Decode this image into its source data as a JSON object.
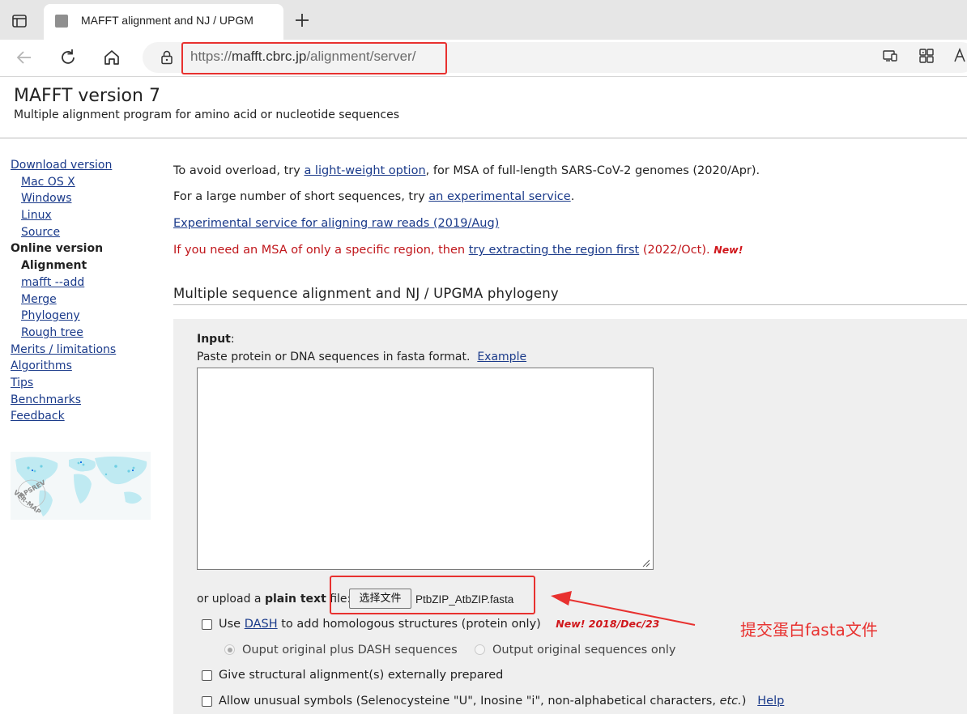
{
  "browser": {
    "tab_title": "MAFFT alignment and NJ / UPGM",
    "url_host_prefix": "https://",
    "url_host": "mafft.cbrc.jp",
    "url_path": "/alignment/server/"
  },
  "header": {
    "title": "MAFFT version 7",
    "subtitle": "Multiple alignment program for amino acid or nucleotide sequences"
  },
  "sidebar": {
    "items": [
      {
        "label": "Download version",
        "kind": "link",
        "indent": false
      },
      {
        "label": "Mac OS X",
        "kind": "link",
        "indent": true
      },
      {
        "label": "Windows",
        "kind": "link",
        "indent": true
      },
      {
        "label": "Linux",
        "kind": "link",
        "indent": true
      },
      {
        "label": "Source",
        "kind": "link",
        "indent": true
      },
      {
        "label": "Online version",
        "kind": "heading",
        "indent": false
      },
      {
        "label": "Alignment",
        "kind": "current",
        "indent": true
      },
      {
        "label": "mafft --add",
        "kind": "link",
        "indent": true
      },
      {
        "label": "Merge",
        "kind": "link",
        "indent": true
      },
      {
        "label": "Phylogeny",
        "kind": "link",
        "indent": true
      },
      {
        "label": "Rough tree",
        "kind": "link",
        "indent": true
      },
      {
        "label": "Merits / limitations",
        "kind": "link",
        "indent": false
      },
      {
        "label": "Algorithms",
        "kind": "link",
        "indent": false
      },
      {
        "label": "Tips",
        "kind": "link",
        "indent": false
      },
      {
        "label": "Benchmarks",
        "kind": "link",
        "indent": false
      },
      {
        "label": "Feedback",
        "kind": "link",
        "indent": false
      }
    ],
    "map_logo_text": "APSREV / VER-MAP"
  },
  "notices": {
    "line1_pre": "To avoid overload, try ",
    "line1_link": "a light-weight option",
    "line1_post": ", for MSA of full-length SARS-CoV-2 genomes (2020/Apr).",
    "line2_pre": "For a large number of short sequences, try ",
    "line2_link": "an experimental service",
    "line2_post": ".",
    "line3_link": "Experimental service for aligning raw reads (2019/Aug)",
    "line4_pre": "If you need an MSA of only a specific region, then ",
    "line4_link": "try extracting the region first",
    "line4_post": " (2022/Oct). ",
    "line4_badge": "New!"
  },
  "section": {
    "title": "Multiple sequence alignment and NJ / UPGMA phylogeny"
  },
  "form": {
    "input_label": "Input",
    "input_label_suffix": ":",
    "input_hint": "Paste protein or DNA sequences in fasta format.",
    "example_link": "Example",
    "sequence_value": "",
    "upload_pre": "or upload a ",
    "upload_bold": "plain text",
    "upload_post": " file:",
    "file_button": "选择文件",
    "file_name": "PtbZIP_AtbZIP.fasta",
    "dash_pre": "Use ",
    "dash_link": "DASH",
    "dash_post": " to add homologous structures (protein only)",
    "dash_badge": "New! 2018/Dec/23",
    "radio_dash_plus": "Ouput original plus DASH sequences",
    "radio_original_only": "Output original sequences only",
    "structural_label": "Give structural alignment(s) externally prepared",
    "unusual_pre": "Allow unusual symbols (Selenocysteine \"U\", Inosine \"i\", non-alphabetical characters, ",
    "unusual_etc": "etc.",
    "unusual_post": ")",
    "help_link": "Help"
  },
  "annotation": {
    "text": "提交蛋白fasta文件",
    "color": "#e8312f"
  }
}
